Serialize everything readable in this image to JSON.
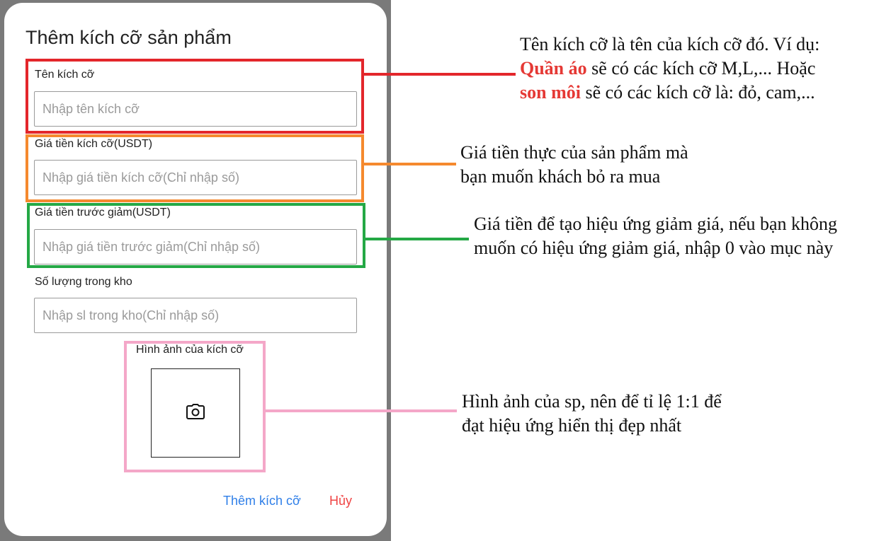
{
  "dialog": {
    "title": "Thêm kích cỡ sản phẩm",
    "fields": [
      {
        "label": "Tên kích cỡ",
        "placeholder": "Nhập tên kích cỡ",
        "value": ""
      },
      {
        "label": "Giá tiền kích cỡ(USDT)",
        "placeholder": "Nhập giá tiền kích cỡ(Chỉ nhập số)",
        "value": ""
      },
      {
        "label": "Giá tiền trước giảm(USDT)",
        "placeholder": "Nhập giá tiền trước giảm(Chỉ nhập số)",
        "value": ""
      },
      {
        "label": "Số lượng trong kho",
        "placeholder": "Nhập sl trong kho(Chỉ nhập số)",
        "value": ""
      }
    ],
    "image": {
      "label": "Hình ảnh của kích cỡ",
      "icon": "camera-icon"
    },
    "actions": {
      "add_label": "Thêm kích cỡ",
      "cancel_label": "Hủy"
    }
  },
  "annotations": {
    "name_note": {
      "line1": "Tên kích cỡ là tên của kích cỡ đó. Ví dụ:",
      "line2_highlight": "Quần áo",
      "line2_rest": " sẽ có các kích cỡ M,L,... Hoặc",
      "line3_highlight": "son môi",
      "line3_rest": " sẽ có các kích cỡ là: đỏ, cam,..."
    },
    "price_note": {
      "line1": "Giá tiền thực của sản phẩm mà",
      "line2": "bạn muốn khách bỏ ra mua"
    },
    "discount_note": {
      "line1": "Giá tiền để tạo hiệu ứng giảm giá, nếu bạn không",
      "line2": "muốn có hiệu ứng giảm giá, nhập 0 vào mục này"
    },
    "image_note": {
      "line1": "Hình ảnh của sp, nên để tỉ lệ 1:1 để",
      "line2": "đạt hiệu ứng hiển thị đẹp nhất"
    }
  },
  "colors": {
    "name_frame": "#e3262b",
    "price_frame": "#f5892e",
    "discount_frame": "#24a845",
    "image_frame": "#f4a7c8",
    "add_button": "#2f7fe8",
    "cancel_button": "#ef4444",
    "highlight_text": "#e53935"
  }
}
